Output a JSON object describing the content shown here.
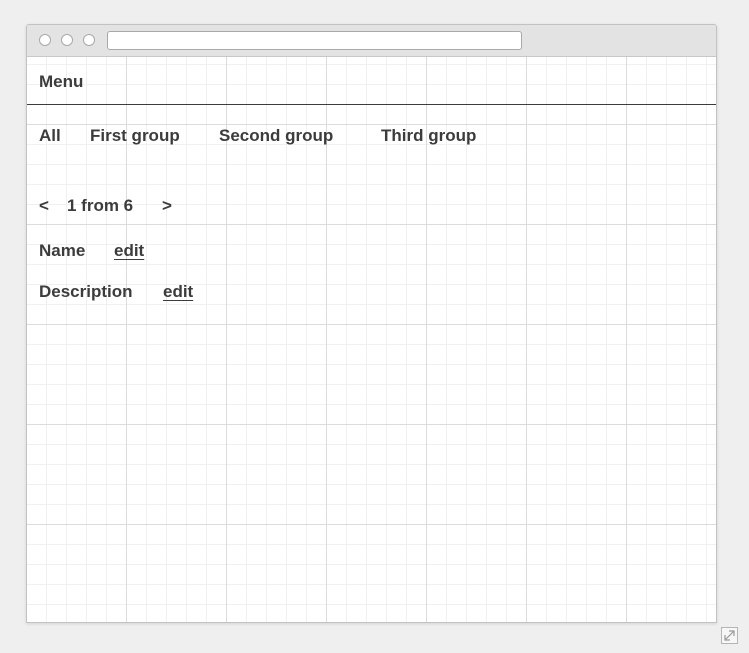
{
  "menu": {
    "label": "Menu"
  },
  "tabs": [
    {
      "label": "All"
    },
    {
      "label": "First group"
    },
    {
      "label": "Second group"
    },
    {
      "label": "Third group"
    }
  ],
  "pager": {
    "prev": "<",
    "status": "1 from 6",
    "next": ">"
  },
  "fields": {
    "name": {
      "label": "Name",
      "action": "edit"
    },
    "description": {
      "label": "Description",
      "action": "edit"
    }
  },
  "icons": {
    "window_controls": [
      "circle-icon",
      "circle-icon",
      "circle-icon"
    ],
    "resize": "expand-icon"
  }
}
